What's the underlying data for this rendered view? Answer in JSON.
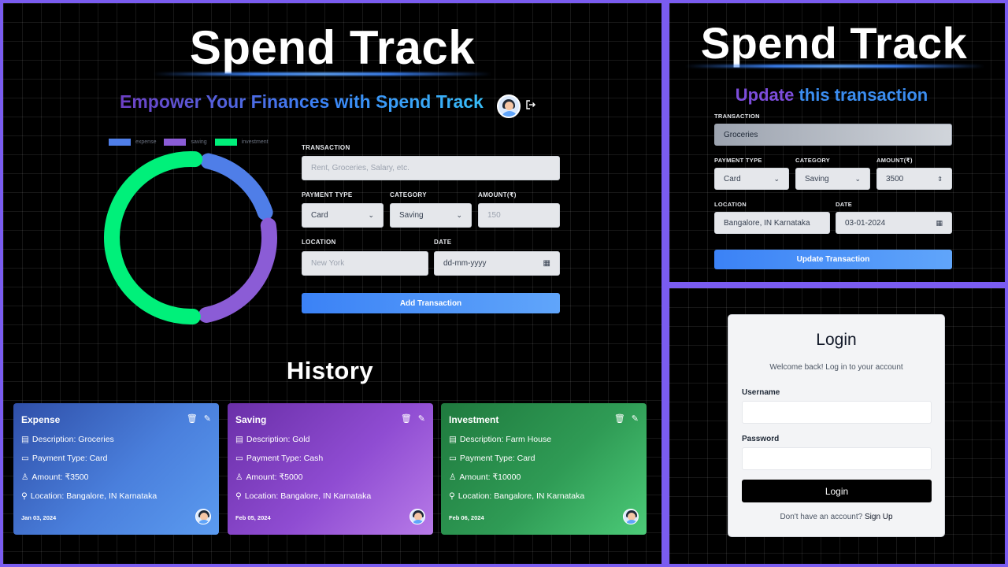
{
  "main": {
    "brand": "Spend Track",
    "tagline": "Empower Your Finances with Spend Track",
    "logout_icon": "logout-icon",
    "legend": [
      {
        "label": "expense",
        "color": "#4f7ee8"
      },
      {
        "label": "saving",
        "color": "#8b5cd6"
      },
      {
        "label": "investment",
        "color": "#00f07a"
      }
    ],
    "form": {
      "transaction_label": "TRANSACTION",
      "transaction_placeholder": "Rent, Groceries, Salary, etc.",
      "payment_type_label": "PAYMENT TYPE",
      "payment_type_value": "Card",
      "category_label": "CATEGORY",
      "category_value": "Saving",
      "amount_label": "AMOUNT(₹)",
      "amount_placeholder": "150",
      "location_label": "LOCATION",
      "location_placeholder": "New York",
      "date_label": "DATE",
      "date_placeholder": "dd-mm-yyyy",
      "submit_label": "Add Transaction"
    },
    "history_title": "History",
    "cards": [
      {
        "title": "Expense",
        "description": "Description: Groceries",
        "payment": "Payment Type: Card",
        "amount": "Amount: ₹3500",
        "location": "Location: Bangalore, IN Karnataka",
        "date": "Jan 03, 2024"
      },
      {
        "title": "Saving",
        "description": "Description: Gold",
        "payment": "Payment Type: Cash",
        "amount": "Amount: ₹5000",
        "location": "Location: Bangalore, IN Karnataka",
        "date": "Feb 05, 2024"
      },
      {
        "title": "Investment",
        "description": "Description: Farm House",
        "payment": "Payment Type: Card",
        "amount": "Amount: ₹10000",
        "location": "Location: Bangalore, IN Karnataka",
        "date": "Feb 06, 2024"
      }
    ]
  },
  "update": {
    "brand": "Spend Track",
    "heading_part1": "Update",
    "heading_part2": "this transaction",
    "transaction_label": "TRANSACTION",
    "transaction_value": "Groceries",
    "payment_type_label": "PAYMENT TYPE",
    "payment_type_value": "Card",
    "category_label": "CATEGORY",
    "category_value": "Saving",
    "amount_label": "AMOUNT(₹)",
    "amount_value": "3500",
    "location_label": "LOCATION",
    "location_value": "Bangalore, IN Karnataka",
    "date_label": "DATE",
    "date_value": "03-01-2024",
    "submit_label": "Update Transaction"
  },
  "login": {
    "title": "Login",
    "subtitle": "Welcome back! Log in to your account",
    "username_label": "Username",
    "password_label": "Password",
    "submit_label": "Login",
    "signup_prompt": "Don't have an account?",
    "signup_link": "Sign Up"
  },
  "chart_data": {
    "type": "pie",
    "categories": [
      "expense",
      "saving",
      "investment"
    ],
    "values": [
      3500,
      5000,
      10000
    ],
    "colors": [
      "#4f7ee8",
      "#8b5cd6",
      "#00f07a"
    ],
    "legend_position": "top"
  }
}
